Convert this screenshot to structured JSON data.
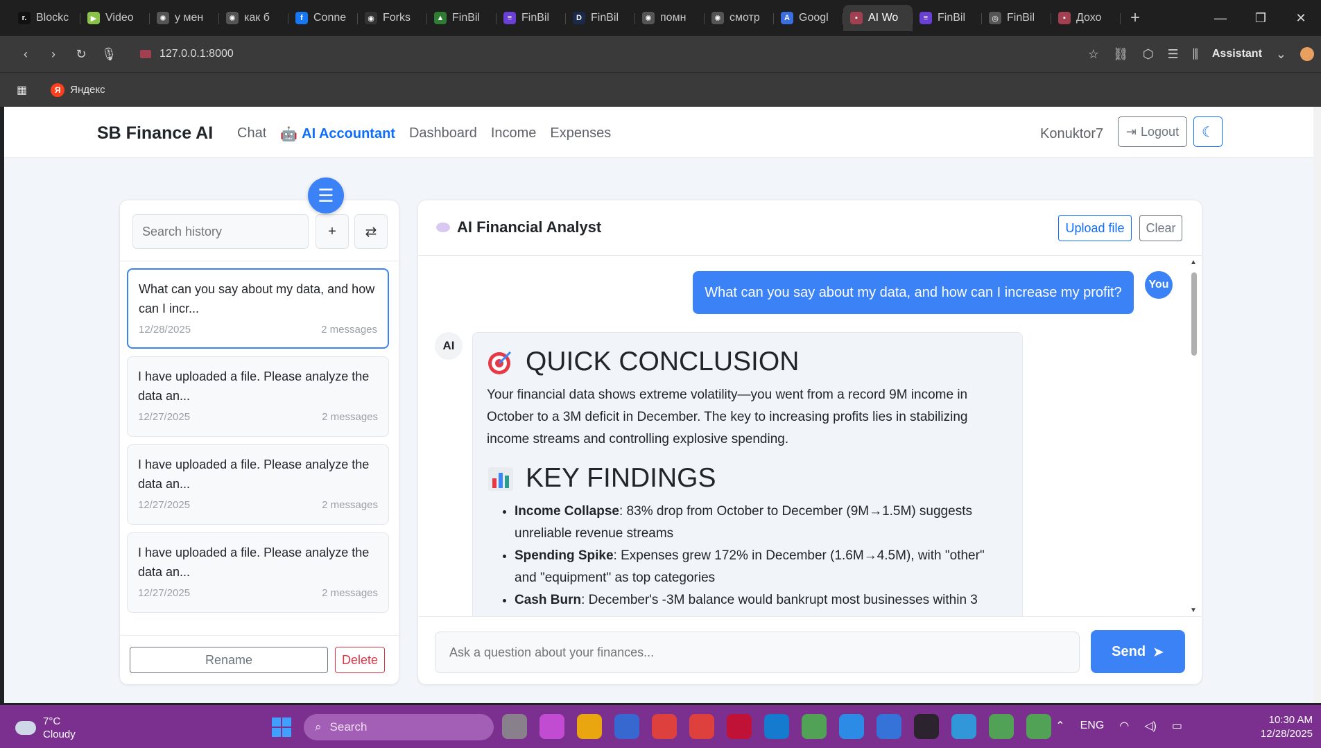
{
  "browser": {
    "tabs": [
      {
        "label": "Blockc",
        "color": "#111111",
        "glyph": "r."
      },
      {
        "label": "Video",
        "color": "#8bc34a",
        "glyph": "▶"
      },
      {
        "label": "у мен",
        "color": "#555555",
        "glyph": "✺"
      },
      {
        "label": "как б",
        "color": "#555555",
        "glyph": "✺"
      },
      {
        "label": "Conne",
        "color": "#1877f2",
        "glyph": "f"
      },
      {
        "label": "Forks",
        "color": "#333333",
        "glyph": "◉"
      },
      {
        "label": "FinBil",
        "color": "#2e7d32",
        "glyph": "▲"
      },
      {
        "label": "FinBil",
        "color": "#6a3fd6",
        "glyph": "≡"
      },
      {
        "label": "FinBil",
        "color": "#1b2a4a",
        "glyph": "D"
      },
      {
        "label": "помн",
        "color": "#555555",
        "glyph": "✺"
      },
      {
        "label": "смотр",
        "color": "#555555",
        "glyph": "✺"
      },
      {
        "label": "Googl",
        "color": "#3b6fe0",
        "glyph": "A"
      },
      {
        "label": "AI Wo",
        "color": "#a04050",
        "glyph": "▪"
      },
      {
        "label": "FinBil",
        "color": "#6a3fd6",
        "glyph": "≡"
      },
      {
        "label": "FinBil",
        "color": "#555555",
        "glyph": "◎"
      },
      {
        "label": "Дохо",
        "color": "#a04050",
        "glyph": "▪"
      }
    ],
    "url": "127.0.0.1:8000",
    "assistant_label": "Assistant",
    "bookmark_yandex": "Яндекс"
  },
  "nav": {
    "brand": "SB Finance AI",
    "links": [
      "Chat",
      "AI Accountant",
      "Dashboard",
      "Income",
      "Expenses"
    ],
    "active_link": "AI Accountant",
    "username": "Konuktor7",
    "logout_label": "Logout"
  },
  "history": {
    "search_placeholder": "Search history",
    "add_label": "+",
    "swap_label": "⇄",
    "items": [
      {
        "title": "What can you say about my data, and how can I incr...",
        "date": "12/28/2025",
        "count": "2 messages"
      },
      {
        "title": "I have uploaded a file. Please analyze the data an...",
        "date": "12/27/2025",
        "count": "2 messages"
      },
      {
        "title": "I have uploaded a file. Please analyze the data an...",
        "date": "12/27/2025",
        "count": "2 messages"
      },
      {
        "title": "I have uploaded a file. Please analyze the data an...",
        "date": "12/27/2025",
        "count": "2 messages"
      }
    ],
    "rename_label": "Rename",
    "delete_label": "Delete"
  },
  "chat": {
    "title": "AI Financial Analyst",
    "upload_label": "Upload file",
    "clear_label": "Clear",
    "user_message": "What can you say about my data, and how can I increase my profit?",
    "user_avatar": "You",
    "ai_avatar": "AI",
    "ai_heading_1": "QUICK CONCLUSION",
    "ai_paragraph": "Your financial data shows extreme volatility—you went from a record 9M income in October to a 3M deficit in December. The key to increasing profits lies in stabilizing income streams and controlling explosive spending.",
    "ai_heading_2": "KEY FINDINGS",
    "findings": [
      {
        "bold": "Income Collapse",
        "text": ": 83% drop from October to December (9M→1.5M) suggests unreliable revenue streams"
      },
      {
        "bold": "Spending Spike",
        "text": ": Expenses grew 172% in December (1.6M→4.5M), with \"other\" and \"equipment\" as top categories"
      },
      {
        "bold": "Cash Burn",
        "text": ": December's -3M balance would bankrupt most businesses within 3"
      }
    ],
    "input_placeholder": "Ask a question about your finances...",
    "send_label": "Send"
  },
  "taskbar": {
    "temp": "7°C",
    "weather": "Cloudy",
    "search_label": "Search",
    "lang": "ENG",
    "time": "10:30 AM",
    "date": "12/28/2025",
    "apps": [
      "#8a8a8a",
      "#c94fd8",
      "#f5b400",
      "#2f6fd6",
      "#e94235",
      "#e94235",
      "#c8102e",
      "#0a84d6",
      "#4caf50",
      "#2496ed",
      "#2d7be0",
      "#222222",
      "#2aa3e0",
      "#4caf50",
      "#4caf50"
    ]
  }
}
